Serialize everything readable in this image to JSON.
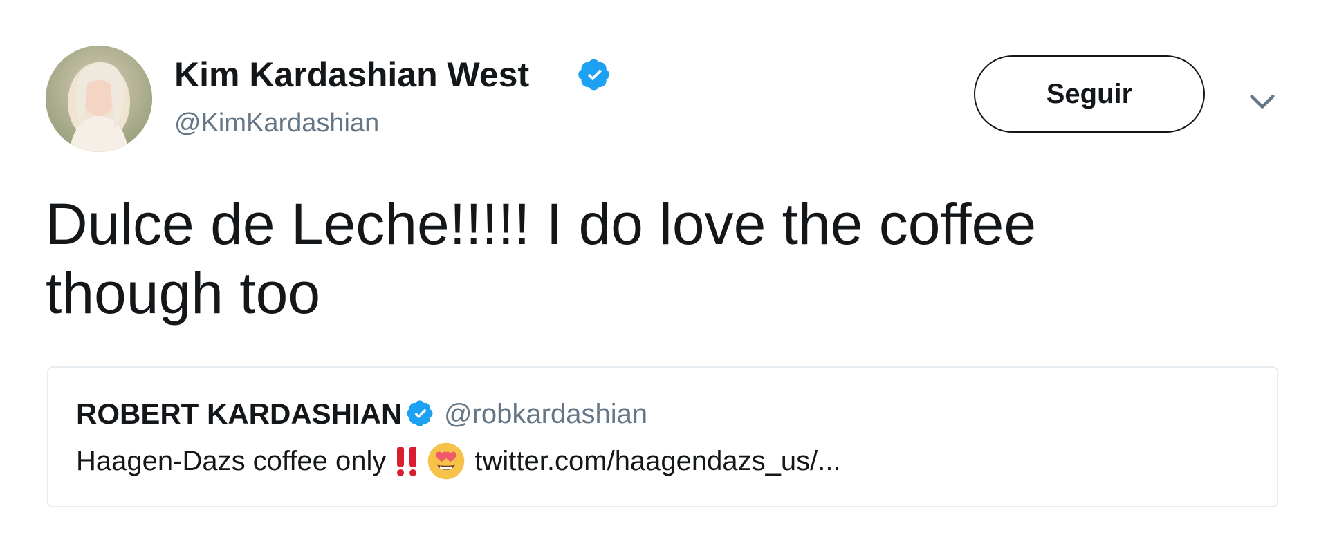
{
  "author": {
    "name": "Kim Kardashian West",
    "handle": "@KimKardashian",
    "verified": true
  },
  "actions": {
    "follow_label": "Seguir"
  },
  "tweet": {
    "text": "Dulce de Leche!!!!! I do love the coffee though too"
  },
  "quoted_tweet": {
    "author_name": "ROBERT KARDASHIAN",
    "author_handle": "@robkardashian",
    "verified": true,
    "text_before": "Haagen-Dazs coffee only",
    "text_after": "twitter.com/haagendazs_us/..."
  },
  "icons": {
    "verified": "verified-badge-icon",
    "menu": "chevron-down-icon",
    "bangbang": "double-exclamation-icon",
    "emoji": "heart-eyes-emoji-icon"
  },
  "colors": {
    "text_primary": "#14171a",
    "text_secondary": "#657786",
    "verified_blue": "#1da1f2",
    "border": "#e6ecf0",
    "bang_red": "#d81e2f",
    "emoji_yellow": "#f6c24a",
    "heart_red": "#f05b6b"
  }
}
